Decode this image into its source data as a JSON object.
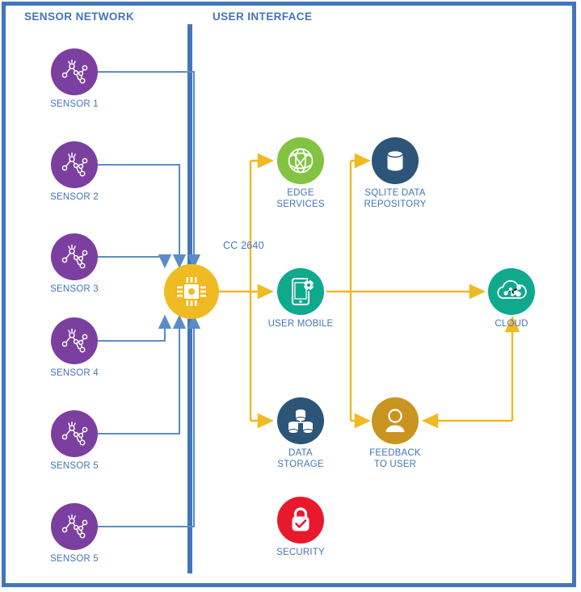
{
  "panels": {
    "left_title": "SENSOR NETWORK",
    "right_title": "USER INTERFACE"
  },
  "colors": {
    "frame": "#4375BC",
    "divider": "#4375BC",
    "text": "#4375BC",
    "sensor": "#7B3FA0",
    "gateway": "#EFBA22",
    "edge_services": "#82C341",
    "sqlite": "#2C5578",
    "user_mobile": "#0FA98E",
    "cloud": "#0FA98E",
    "data_storage": "#2C5578",
    "feedback": "#C9941F",
    "security": "#E8192C",
    "sensor_link": "#5B8CC8",
    "data_flow": "#EFBA22"
  },
  "sensors": [
    {
      "label": "SENSOR  1",
      "icon": "sensor-network-icon"
    },
    {
      "label": "SENSOR 2",
      "icon": "sensor-network-icon"
    },
    {
      "label": "SENSOR 3",
      "icon": "sensor-network-icon"
    },
    {
      "label": "SENSOR 4",
      "icon": "sensor-network-icon"
    },
    {
      "label": "SENSOR 5",
      "icon": "sensor-network-icon"
    },
    {
      "label": "SENSOR 5",
      "icon": "sensor-network-icon"
    }
  ],
  "gateway": {
    "icon": "microchip-icon",
    "link_label": "CC 2640"
  },
  "nodes": {
    "edge_services": {
      "label_line1": "EDGE",
      "label_line2": "SERVICES",
      "icon": "globe-mesh-icon"
    },
    "sqlite": {
      "label_line1": "SQLITE DATA",
      "label_line2": "REPOSITORY",
      "icon": "database-cylinder-icon"
    },
    "user_mobile": {
      "label_line1": "USER MOBILE",
      "label_line2": "",
      "icon": "mobile-gear-icon"
    },
    "cloud": {
      "label_line1": "CLOUD",
      "label_line2": "",
      "icon": "cloud-network-icon"
    },
    "data_storage": {
      "label_line1": "DATA",
      "label_line2": "STORAGE",
      "icon": "stacked-databases-icon"
    },
    "feedback": {
      "label_line1": "FEEDBACK",
      "label_line2": "TO USER",
      "icon": "user-person-icon"
    },
    "security": {
      "label_line1": "SECURITY",
      "label_line2": "",
      "icon": "padlock-check-icon"
    }
  }
}
